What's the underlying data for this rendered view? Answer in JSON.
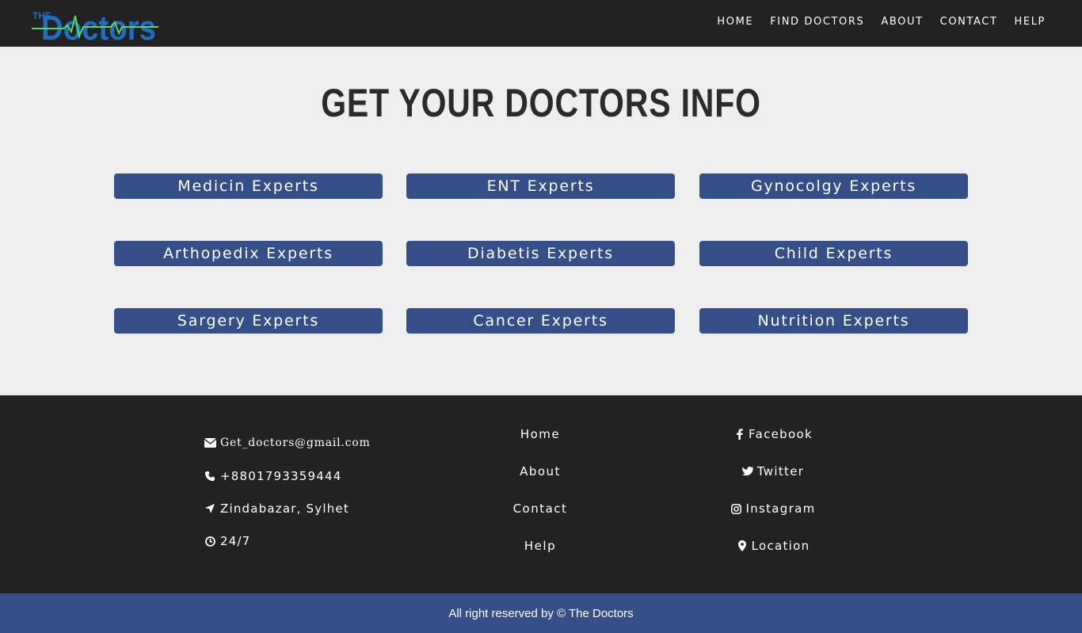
{
  "brand": {
    "logo_small": "THE",
    "logo_main": "Doctors"
  },
  "nav": {
    "items": [
      "HOME",
      "FIND DOCTORS",
      "ABOUT",
      "CONTACT",
      "HELP"
    ]
  },
  "main": {
    "title": "GET YOUR DOCTORS INFO",
    "experts": [
      "Medicin Experts",
      "ENT Experts",
      "Gynocolgy Experts",
      "Arthopedix Experts",
      "Diabetis Experts",
      "Child Experts",
      "Sargery Experts",
      "Cancer Experts",
      "Nutrition Experts"
    ]
  },
  "footer": {
    "contact": {
      "email": "Get_doctors@gmail.com",
      "phone": "+8801793359444",
      "address": "Zindabazar, Sylhet",
      "hours": "24/7"
    },
    "links": [
      "Home",
      "About",
      "Contact",
      "Help"
    ],
    "social": [
      "Facebook",
      "Twitter",
      "Instagram",
      "Location"
    ],
    "copyright": "All right reserved by © The Doctors"
  },
  "colors": {
    "nav_bg": "#222222",
    "accent": "#344f87",
    "page_bg": "#eeeeee",
    "logo_blue": "#1e6fc0",
    "logo_green": "#5fd35f"
  }
}
